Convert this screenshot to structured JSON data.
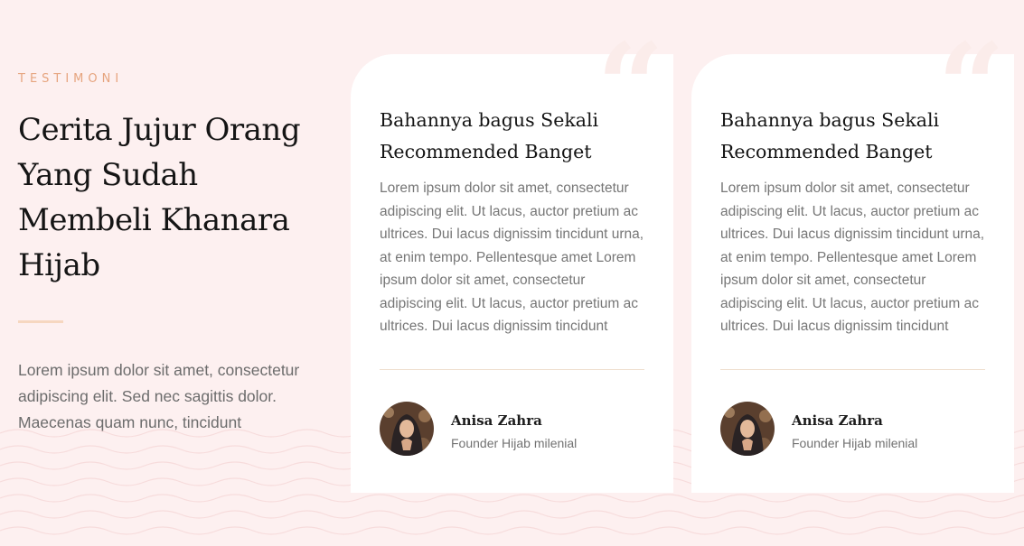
{
  "section": {
    "eyebrow": "TESTIMONI",
    "heading": "Cerita Jujur Orang Yang Sudah Membeli Khanara Hijab",
    "description": "Lorem ipsum dolor sit amet, consectetur adipiscing elit. Sed nec sagittis dolor. Maecenas quam nunc, tincidunt"
  },
  "testimonials": [
    {
      "title": "Bahannya bagus Sekali Recommended Banget",
      "body": "Lorem ipsum dolor sit amet, consectetur adipiscing elit. Ut lacus, auctor pretium ac ultrices. Dui lacus dignissim tincidunt urna, at enim tempo. Pellentesque amet Lorem ipsum dolor sit amet, consectetur adipiscing elit. Ut lacus, auctor pretium ac ultrices. Dui lacus dignissim tincidunt",
      "author_name": "Anisa Zahra",
      "author_role": "Founder Hijab milenial",
      "quote_icon": "quote-icon",
      "avatar_icon": "avatar-photo"
    },
    {
      "title": "Bahannya bagus Sekali Recommended Banget",
      "body": "Lorem ipsum dolor sit amet, consectetur adipiscing elit. Ut lacus, auctor pretium ac ultrices. Dui lacus dignissim tincidunt urna, at enim tempo. Pellentesque amet Lorem ipsum dolor sit amet, consectetur adipiscing elit. Ut lacus, auctor pretium ac ultrices. Dui lacus dignissim tincidunt",
      "author_name": "Anisa Zahra",
      "author_role": "Founder Hijab milenial",
      "quote_icon": "quote-icon",
      "avatar_icon": "avatar-photo"
    }
  ],
  "colors": {
    "background": "#fdf0f0",
    "accent": "#e6a47e",
    "divider": "#f6d7c0",
    "card": "#ffffff"
  }
}
